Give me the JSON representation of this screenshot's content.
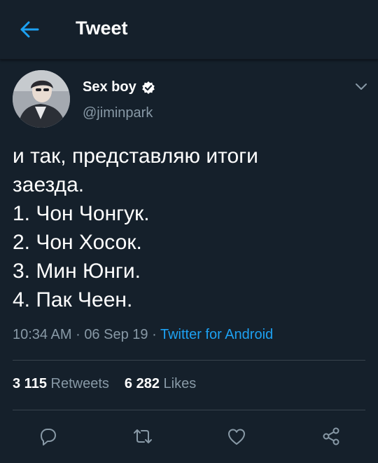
{
  "header": {
    "title": "Tweet",
    "back_icon": "arrow-left-icon",
    "accent_color": "#1da1f2"
  },
  "author": {
    "name": "Sex boy",
    "handle": "@jiminpark",
    "verified_icon": "verified-badge-icon"
  },
  "tweet": {
    "lines": [
      "и так, представляю итоги",
      "заезда.",
      "1. Чон Чонгук.",
      "2. Чон Хосок.",
      "3. Мин Юнги.",
      "4. Пак Чеен."
    ],
    "time": "10:34 AM",
    "date": "06 Sep 19",
    "separator": "·",
    "source": "Twitter for Android"
  },
  "stats": {
    "retweets_count": "3 115",
    "retweets_label": "Retweets",
    "likes_count": "6 282",
    "likes_label": "Likes"
  },
  "actions": [
    "reply-icon",
    "retweet-icon",
    "like-icon",
    "share-icon"
  ],
  "colors": {
    "background": "#15202b",
    "secondary_text": "#8899a6",
    "divider": "#38444d"
  }
}
